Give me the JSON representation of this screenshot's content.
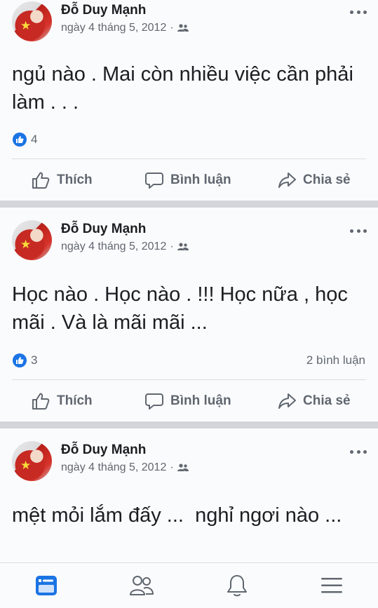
{
  "posts": [
    {
      "author": "Đỗ Duy Mạnh",
      "date": "ngày 4 tháng 5, 2012",
      "separator": "·",
      "text": "ngủ nào . Mai còn nhiều việc cần phải làm . . .",
      "likes": "4",
      "comments": ""
    },
    {
      "author": "Đỗ Duy Mạnh",
      "date": "ngày 4 tháng 5, 2012",
      "separator": "·",
      "text": "Học nào . Học nào . !!! Học nữa , học mãi . Và là mãi mãi ...",
      "likes": "3",
      "comments": "2 bình luận"
    },
    {
      "author": "Đỗ Duy Mạnh",
      "date": "ngày 4 tháng 5, 2012",
      "separator": "·",
      "text": "mệt mỏi lắm đấy ...  nghỉ ngơi nào ..."
    }
  ],
  "actions": {
    "like": "Thích",
    "comment": "Bình luận",
    "share": "Chia sẻ"
  },
  "colors": {
    "accent": "#1b74e4",
    "text": "#1c1e21",
    "secondary": "#606770",
    "separator": "#d3d5da"
  },
  "tabbar": {
    "icons": [
      "news-feed-icon",
      "friends-icon",
      "notifications-icon",
      "menu-icon"
    ],
    "active": "news-feed-icon"
  }
}
